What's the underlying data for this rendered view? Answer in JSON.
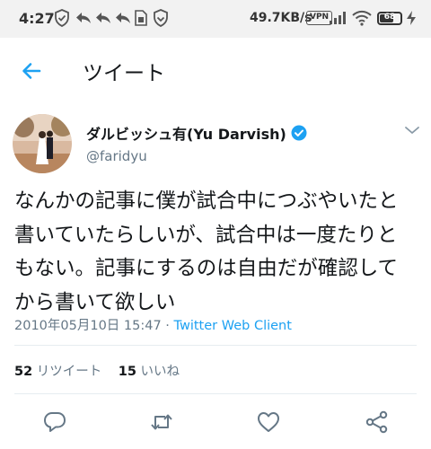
{
  "status_bar": {
    "time": "4:27",
    "network_speed": "49.7KB/s",
    "vpn_label": "VPN",
    "battery": "68",
    "battery_level": 0.68
  },
  "header": {
    "back_icon": "arrow-left-icon",
    "title": "ツイート"
  },
  "tweet": {
    "author_name": "ダルビッシュ有(Yu Darvish)",
    "verified": true,
    "handle": "@faridyu",
    "text_lines": [
      "なんかの記事に僕が試合中につぶやいたと",
      "書いていたらしいが、試合中は一度たりと",
      "もない。記事にするのは自由だが確認して",
      "から書いて欲しい"
    ],
    "timestamp": "2010年05月10日 15:47 · ",
    "client": "Twitter Web Client",
    "retweets_count": "52",
    "retweets_label": "リツイート",
    "likes_count": "15",
    "likes_label": "いいね"
  },
  "colors": {
    "accent": "#1da1f2",
    "secondary_text": "#657786",
    "divider": "#e6ecf0"
  }
}
